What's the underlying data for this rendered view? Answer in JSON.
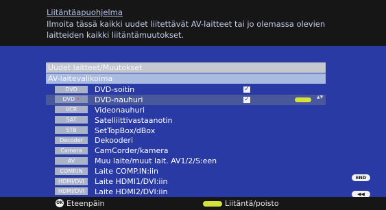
{
  "header": {
    "title": "Liitäntäapuohjelma",
    "description": "Ilmoita tässä kaikki uudet liitettävät AV-laitteet tai jo olemassa olevien laitteiden kaikki liitäntämuutokset."
  },
  "panel": {
    "heading": "Uudet laitteet/Muutokset",
    "subheading": "AV-laitevalikoima"
  },
  "devices": [
    {
      "tag": "DVD",
      "label": "DVD-soitin",
      "checked": true
    },
    {
      "tag": "DVD",
      "label": "DVD-nauhuri",
      "checked": true,
      "selected": true
    },
    {
      "tag": "VCR",
      "label": "Videonauhuri"
    },
    {
      "tag": "SAT",
      "label": "Satelliittivastaanotin"
    },
    {
      "tag": "STB",
      "label": "SetTopBox/dBox"
    },
    {
      "tag": "Decoder",
      "label": "Dekooderi"
    },
    {
      "tag": "Camera",
      "label": "CamCorder/kamera"
    },
    {
      "tag": "AV",
      "label": "Muu laite/muut lait. AV1/2/S:een"
    },
    {
      "tag": "COMP.IN",
      "label": "Laite COMP.IN:iin"
    },
    {
      "tag": "HDMI/DVI",
      "label": "Laite HDMI1/DVI:iin"
    },
    {
      "tag": "HDMI/DVI",
      "label": "Laite HDMI2/DVI:iin"
    }
  ],
  "checkmark": "✓",
  "tag_dot": "•",
  "scroll_arrows": "▲▼",
  "footer": {
    "ok_badge": "OK",
    "ok_label": "Eteenpäin",
    "yellow_label": "Liitäntä/poisto"
  },
  "side_buttons": {
    "end": "END",
    "back": "◀◀"
  },
  "colors": {
    "accent_yellow": "#d6e23a",
    "panel_blue": "#2a3aa4",
    "selected_row": "#49579b"
  }
}
